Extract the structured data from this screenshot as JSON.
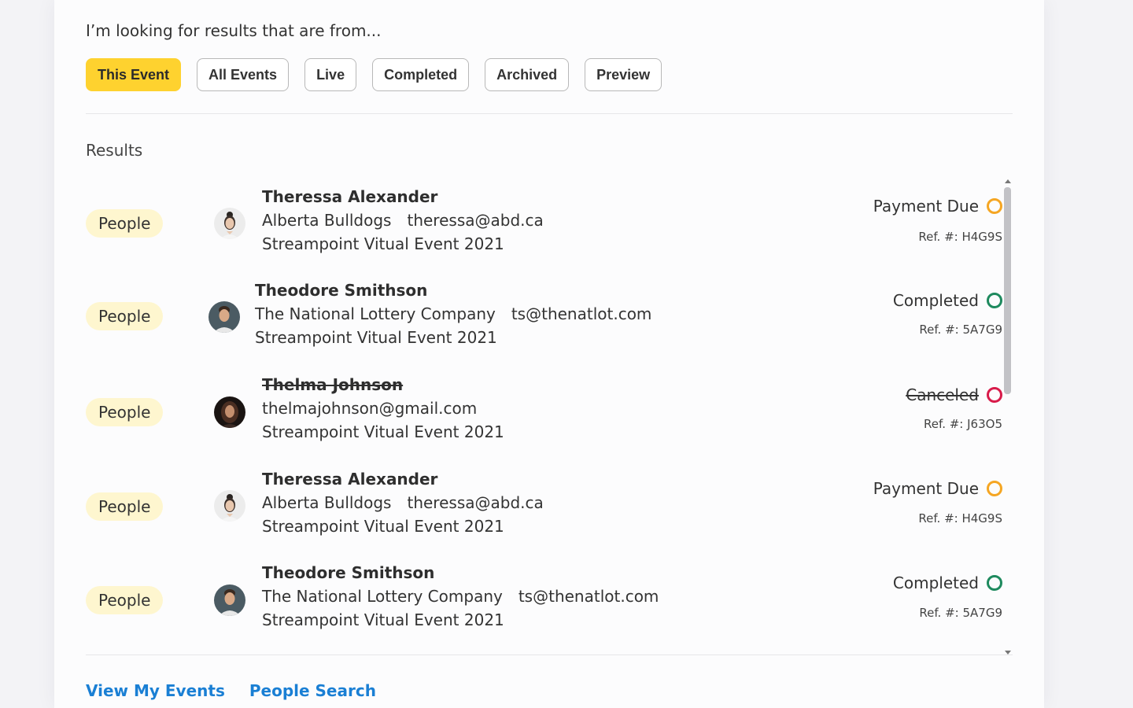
{
  "prompt": "I’m looking for results that are from...",
  "filters": [
    {
      "label": "This Event",
      "active": true
    },
    {
      "label": "All Events",
      "active": false
    },
    {
      "label": "Live",
      "active": false
    },
    {
      "label": "Completed",
      "active": false
    },
    {
      "label": "Archived",
      "active": false
    },
    {
      "label": "Preview",
      "active": false
    }
  ],
  "results_label": "Results",
  "results": [
    {
      "tag": "People",
      "name": "Theressa Alexander",
      "name_strike": false,
      "details": [
        "Alberta Bulldogs",
        "theressa@abd.ca"
      ],
      "event": "Streampoint Vitual Event 2021",
      "status": "Payment Due",
      "status_color": "#f5a623",
      "status_strike": false,
      "ref": "Ref. #: H4G9S",
      "avatar": "woman-light-avatar"
    },
    {
      "tag": "People",
      "name": "Theodore Smithson",
      "name_strike": false,
      "details": [
        "The National Lottery Company",
        "ts@thenatlot.com"
      ],
      "event": "Streampoint Vitual Event 2021",
      "status": "Completed",
      "status_color": "#1e8a5e",
      "status_strike": false,
      "ref": "Ref. #: 5A7G9",
      "avatar": "man-avatar"
    },
    {
      "tag": "People",
      "name": "Thelma Johnson",
      "name_strike": true,
      "details": [
        "thelmajohnson@gmail.com"
      ],
      "event": "Streampoint Vitual Event 2021",
      "status": "Canceled",
      "status_color": "#d81b4a",
      "status_strike": true,
      "ref": "Ref. #: J63O5",
      "avatar": "woman-dark-avatar"
    },
    {
      "tag": "People",
      "name": "Theressa Alexander",
      "name_strike": false,
      "details": [
        "Alberta Bulldogs",
        "theressa@abd.ca"
      ],
      "event": "Streampoint Vitual Event 2021",
      "status": "Payment Due",
      "status_color": "#f5a623",
      "status_strike": false,
      "ref": "Ref. #: H4G9S",
      "avatar": "woman-light-avatar"
    },
    {
      "tag": "People",
      "name": "Theodore Smithson",
      "name_strike": false,
      "details": [
        "The National Lottery Company",
        "ts@thenatlot.com"
      ],
      "event": "Streampoint Vitual Event 2021",
      "status": "Completed",
      "status_color": "#1e8a5e",
      "status_strike": false,
      "ref": "Ref. #: 5A7G9",
      "avatar": "man-avatar"
    }
  ],
  "footer": {
    "view_my_events": "View My Events",
    "people_search": "People Search"
  }
}
